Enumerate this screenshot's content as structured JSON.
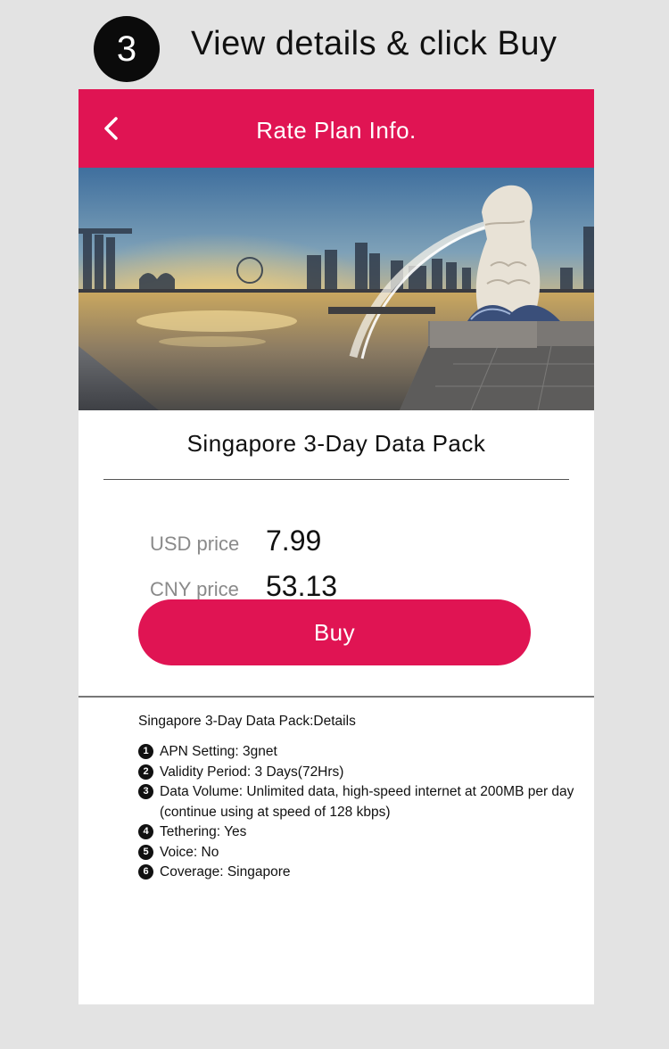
{
  "step": {
    "number": "3",
    "title": "View details & click Buy"
  },
  "navbar": {
    "title": "Rate Plan Info."
  },
  "hero": {
    "image": "singapore-merlion-skyline"
  },
  "pack": {
    "title": "Singapore 3-Day Data Pack"
  },
  "prices": {
    "usd_label": "USD price",
    "usd_value": "7.99",
    "cny_label": "CNY price",
    "cny_value": "53.13"
  },
  "buy_button": {
    "label": "Buy"
  },
  "details": {
    "heading": "Singapore 3-Day Data Pack:Details",
    "items": [
      {
        "num": "1",
        "text": "APN Setting:  3gnet"
      },
      {
        "num": "2",
        "text": "Validity Period: 3 Days(72Hrs)"
      },
      {
        "num": "3",
        "text": "Data Volume: Unlimited data, high-speed internet at 200MB per day (continue using at speed of 128 kbps)"
      },
      {
        "num": "4",
        "text": "Tethering: Yes"
      },
      {
        "num": "5",
        "text": "Voice: No"
      },
      {
        "num": "6",
        "text": "Coverage: Singapore"
      }
    ]
  },
  "colors": {
    "accent": "#e01453",
    "background": "#e3e3e3"
  }
}
